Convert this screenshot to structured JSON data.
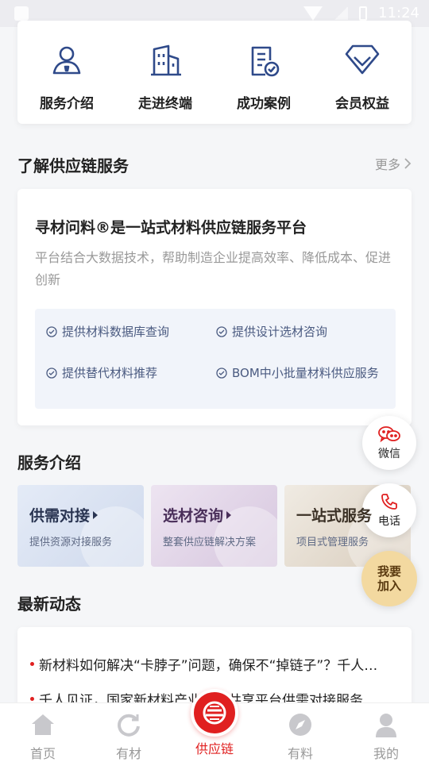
{
  "status_bar": {
    "time": "11:24"
  },
  "quick_entries": [
    {
      "label": "服务介绍",
      "icon": "user-badge-icon"
    },
    {
      "label": "走进终端",
      "icon": "building-icon"
    },
    {
      "label": "成功案例",
      "icon": "document-check-icon"
    },
    {
      "label": "会员权益",
      "icon": "diamond-icon"
    }
  ],
  "understand_section": {
    "title": "了解供应链服务",
    "more_label": "更多"
  },
  "intro": {
    "title": "寻材问料®是一站式材料供应链服务平台",
    "description": "平台结合大数据技术，帮助制造企业提高效率、降低成本、促进创新",
    "features": [
      "提供材料数据库查询",
      "提供设计选材咨询",
      "提供替代材料推荐",
      "BOM中小批量材料供应服务"
    ]
  },
  "services_section": {
    "title": "服务介绍",
    "tiles": [
      {
        "title": "供需对接",
        "subtitle": "提供资源对接服务"
      },
      {
        "title": "选材咨询",
        "subtitle": "整套供应链解决方案"
      },
      {
        "title": "一站式服务",
        "subtitle": "项目式管理服务"
      }
    ]
  },
  "news_section": {
    "title": "最新动态",
    "items": [
      "新材料如何解决“卡脖子”问题，确保不“掉链子”？千人见证",
      "千人见证，国家新材料产业资源共享平台供需对接服务"
    ]
  },
  "floating": {
    "wechat_label": "微信",
    "phone_label": "电话",
    "join_line1": "我要",
    "join_line2": "加入"
  },
  "tabbar": [
    {
      "label": "首页",
      "icon": "home-icon",
      "active": false
    },
    {
      "label": "有材",
      "icon": "refresh-circle-icon",
      "active": false
    },
    {
      "label": "供应链",
      "icon": "supply-chain-icon",
      "active": true
    },
    {
      "label": "有料",
      "icon": "compass-icon",
      "active": false
    },
    {
      "label": "我的",
      "icon": "profile-icon",
      "active": false
    }
  ],
  "colors": {
    "accent": "#e02020",
    "icon_blue": "#2f4a8a",
    "join_gold": "#f3d9a0"
  }
}
